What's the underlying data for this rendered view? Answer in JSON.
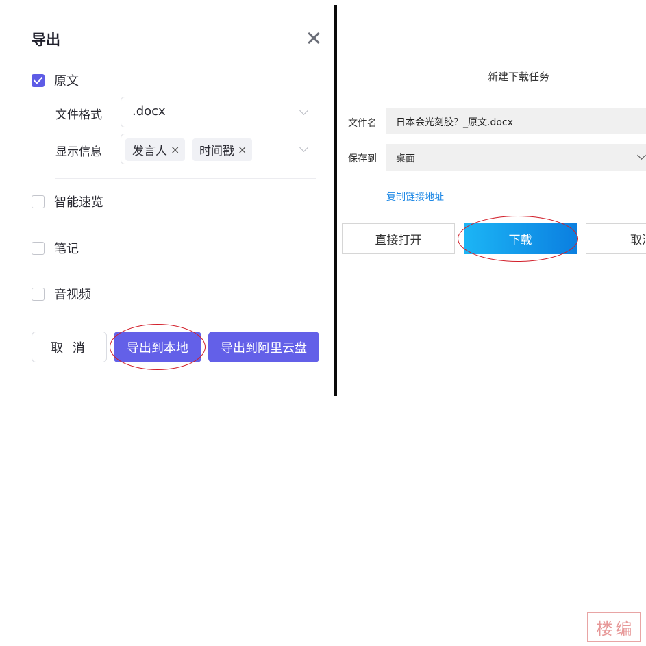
{
  "export_dialog": {
    "title": "导出",
    "options": {
      "original": {
        "label": "原文",
        "checked": true
      },
      "smart_overview": {
        "label": "智能速览",
        "checked": false
      },
      "notes": {
        "label": "笔记",
        "checked": false
      },
      "audio_video": {
        "label": "音视频",
        "checked": false
      }
    },
    "file_format": {
      "label": "文件格式",
      "value": ".docx"
    },
    "display_info": {
      "label": "显示信息",
      "tags": [
        "发言人",
        "时间戳"
      ],
      "remove_glyph": "×"
    },
    "buttons": {
      "cancel": "取 消",
      "export_local": "导出到本地",
      "export_aliyun": "导出到阿里云盘"
    },
    "accent_color": "#6360e8"
  },
  "download_dialog": {
    "title": "新建下载任务",
    "filename": {
      "label": "文件名",
      "value": "日本会光刻胶？_原文.docx"
    },
    "save_to": {
      "label": "保存到",
      "value": "桌面"
    },
    "copy_link": "复制链接地址",
    "buttons": {
      "open_directly": "直接打开",
      "download": "下载",
      "cancel": "取消"
    },
    "accent_color": "#0b7fe0",
    "link_color": "#1e88e5"
  },
  "annotation_color": "#d21f2a",
  "watermark": {
    "text": "楼编"
  }
}
